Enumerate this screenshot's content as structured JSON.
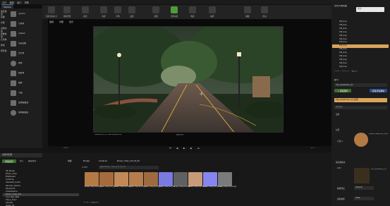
{
  "menubar": {
    "items": [
      "文件",
      "编辑",
      "窗口",
      "帮助"
    ]
  },
  "tab": {
    "label": "MyMap"
  },
  "toolbar": {
    "buttons": [
      {
        "label": "保存当前关卡",
        "icon": "save-icon"
      },
      {
        "label": "源码管理",
        "icon": "source-control-icon"
      },
      {
        "label": "模式",
        "icon": "modes-icon"
      },
      {
        "label": "内容",
        "icon": "content-icon"
      },
      {
        "label": "市场",
        "icon": "marketplace-icon"
      },
      {
        "label": "设置",
        "icon": "settings-icon"
      },
      {
        "label": "蓝图",
        "icon": "blueprint-icon"
      },
      {
        "label": "过场动画",
        "icon": "cinematics-icon"
      },
      {
        "label": "构建",
        "icon": "build-icon"
      },
      {
        "label": "编译",
        "icon": "compile-icon"
      },
      {
        "label": "播放",
        "icon": "play-icon"
      },
      {
        "label": "启动",
        "icon": "launch-icon"
      }
    ]
  },
  "left_panel": {
    "categories": [
      "最近放置",
      "基础",
      "光源",
      "过场动画",
      "视觉效果",
      "几何体",
      "体积",
      "所有类"
    ],
    "items": [
      "空Actor",
      "空角色",
      "空Pawn",
      "玩家起始",
      "立方体",
      "球体",
      "圆柱体",
      "锥体",
      "平面",
      "盒体触发器",
      "球体触发器"
    ]
  },
  "viewport": {
    "mode_buttons": [
      "透视",
      "光照",
      "显示"
    ],
    "caption_left": "Sequence_01 (Sub-sequence)",
    "caption_center": "最终场景",
    "timecode_bottom": "0000",
    "timecode_end": "0250"
  },
  "outliner": {
    "title": "世界大纲视图",
    "search_placeholder": "搜索...",
    "rows": [
      "SM_tree",
      "SM_tree",
      "SM_tree",
      "SM_tree",
      "SM_tree",
      "SM_tree",
      "SM_tree",
      "SM_tree",
      "SM_tree",
      "SM_tree",
      "SM_tree",
      "SM_tree",
      "SM_tree",
      "SM_tree"
    ],
    "selected_index": 7,
    "footer": "5,234 个Actor (1 个被选中)"
  },
  "details": {
    "title": "细节",
    "actor_name": "SM_streetlamp_01",
    "add_component": "+ 添加组件",
    "blueprint_button": "蓝图/添加脚本",
    "component": "SM_streetlamp_01(实例)",
    "search_placeholder": "搜索细节",
    "section_transform": "变换",
    "section_material": "材质",
    "material_slot": "元素 0",
    "material_name": "Brown_Tiles_2x2_M_00",
    "section_lod": "静态网格体",
    "lod_label": "LOD",
    "static_mesh": "SM_streetlamp_01",
    "collision_label": "碰撞预设",
    "collision_value": "Default",
    "physics_label": "模拟物理",
    "physics_value": "False"
  },
  "content_browser": {
    "tab_label": "内容浏览器",
    "add_new": "添加新项",
    "import": "导入",
    "save_all": "保存所有",
    "breadcrumb": [
      "内容",
      "Bridge",
      "Surfaces",
      "Brown_Tiles_2x2_M_00"
    ],
    "filter_label": "过滤器",
    "search_placeholder": "搜索 Brown_Tiles_2x2_M_00",
    "folders": [
      "SE_Plants",
      "Brown_Tiles",
      "MSPresets",
      "Surfaces",
      "Sidewalk_Grass",
      "Wooden_Planks",
      "Pavement",
      "Cobblestone",
      "Brown_Tiles_2x2",
      "Concrete_Wall",
      "Stone_Floor",
      "Asphalt",
      "Grass_01"
    ],
    "selected_folder_index": 8,
    "assets": [
      {
        "name": "Brown_Tiles_2x2_M_00",
        "color": "#b47a46"
      },
      {
        "name": "Brown_Tiles_2x2_M_01",
        "color": "#a56b3c"
      },
      {
        "name": "Brown_Tiles_2x2_M_02",
        "color": "#c18957"
      },
      {
        "name": "Brown_Tiles_2x2_M_03",
        "color": "#b67d4c"
      },
      {
        "name": "Brown_Tiles_2x2_M_04",
        "color": "#9e6a3f"
      },
      {
        "name": "Brown_Tiles_2x2_Inst",
        "color": "#7a7ae0"
      },
      {
        "name": "Brown_Tiles_2x2_Mask",
        "color": "#606060"
      },
      {
        "name": "Brown_Tiles_2x2_Albedo",
        "color": "#c79a78"
      },
      {
        "name": "Brown_Tiles_2x2_Normal",
        "color": "#8686f0"
      },
      {
        "name": "Brown_Tiles_2x2_Rough",
        "color": "#7b7b7b"
      }
    ],
    "status": "13 项 (1 项被选中)"
  },
  "colors": {
    "accent": "#d9a45b",
    "green": "#3b6e2c",
    "selection": "#3a6ea5"
  }
}
